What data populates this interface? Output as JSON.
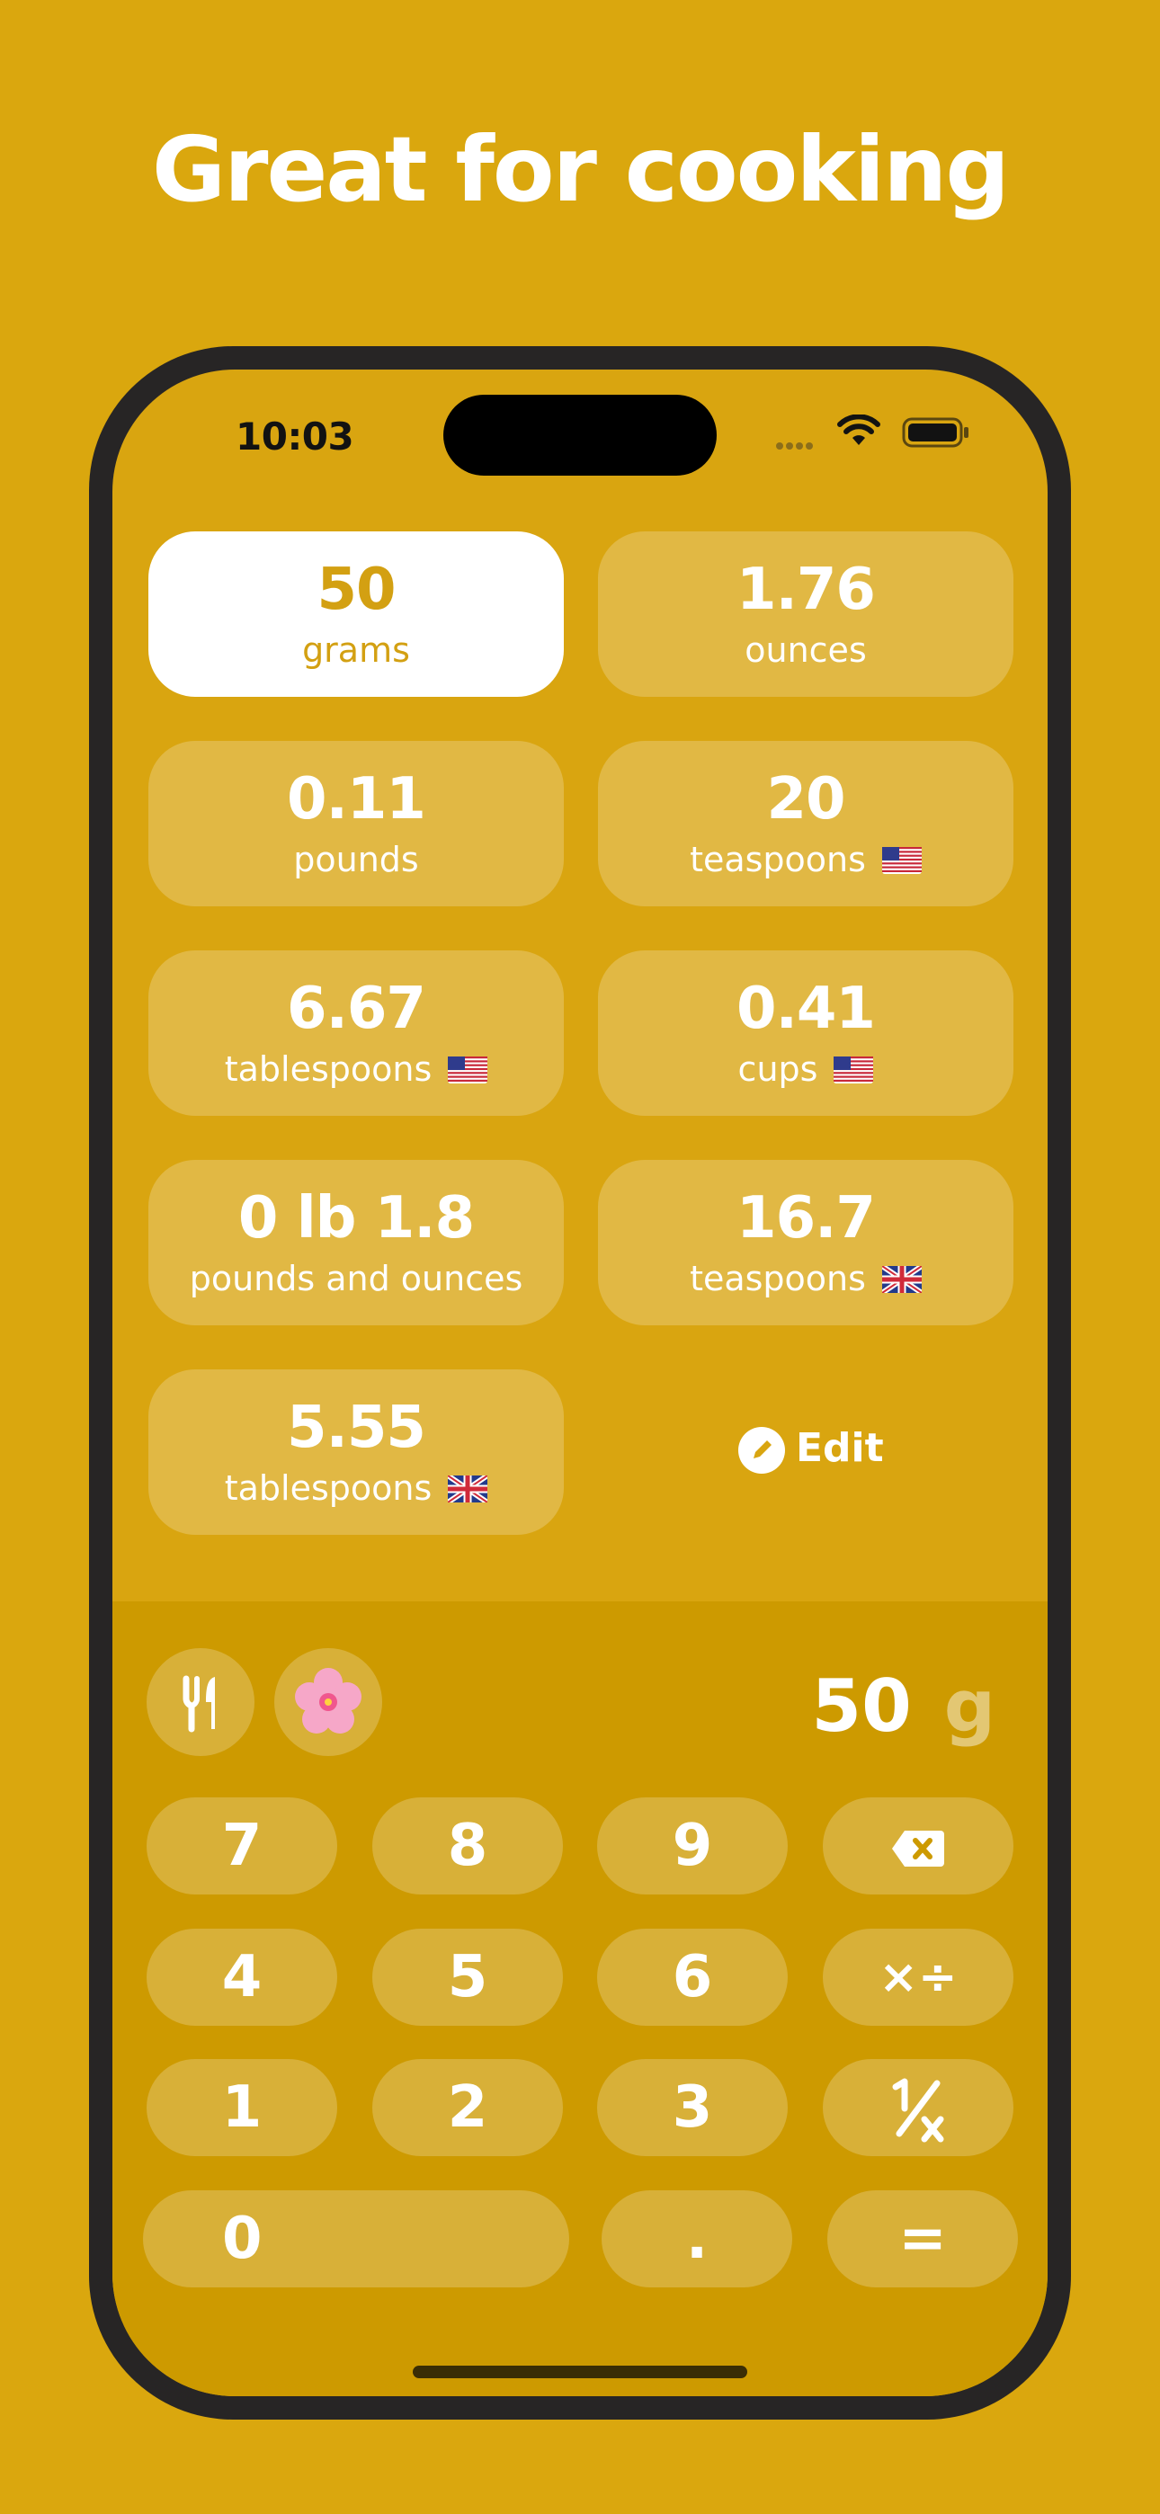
{
  "headline": "Great for cooking",
  "status": {
    "time": "10:03"
  },
  "conversions": [
    {
      "value": "50",
      "unit": "grams",
      "flag": "",
      "selected": true
    },
    {
      "value": "1.76",
      "unit": "ounces",
      "flag": ""
    },
    {
      "value": "0.11",
      "unit": "pounds",
      "flag": ""
    },
    {
      "value": "20",
      "unit": "teaspoons",
      "flag": "us-flag"
    },
    {
      "value": "6.67",
      "unit": "tablespoons",
      "flag": "us-flag"
    },
    {
      "value": "0.41",
      "unit": "cups",
      "flag": "us-flag"
    },
    {
      "value": "0 lb 1.8",
      "unit": "pounds and ounces",
      "flag": ""
    },
    {
      "value": "16.7",
      "unit": "teaspoons",
      "flag": "uk-flag"
    },
    {
      "value": "5.55",
      "unit": "tablespoons",
      "flag": "uk-flag"
    }
  ],
  "edit_label": "Edit",
  "input": {
    "value": "50",
    "unit": "g"
  },
  "category_icons": [
    "fork-knife-icon",
    "flower-icon"
  ],
  "keys": {
    "k7": "7",
    "k8": "8",
    "k9": "9",
    "k4": "4",
    "k5": "5",
    "k6": "6",
    "k1": "1",
    "k2": "2",
    "k3": "3",
    "k0": "0",
    "dot": ".",
    "equals": "=",
    "ops": "×÷"
  },
  "colors": {
    "background": "#DAA70E",
    "accent": "#D3A012",
    "keypad": "#CD9A00"
  }
}
